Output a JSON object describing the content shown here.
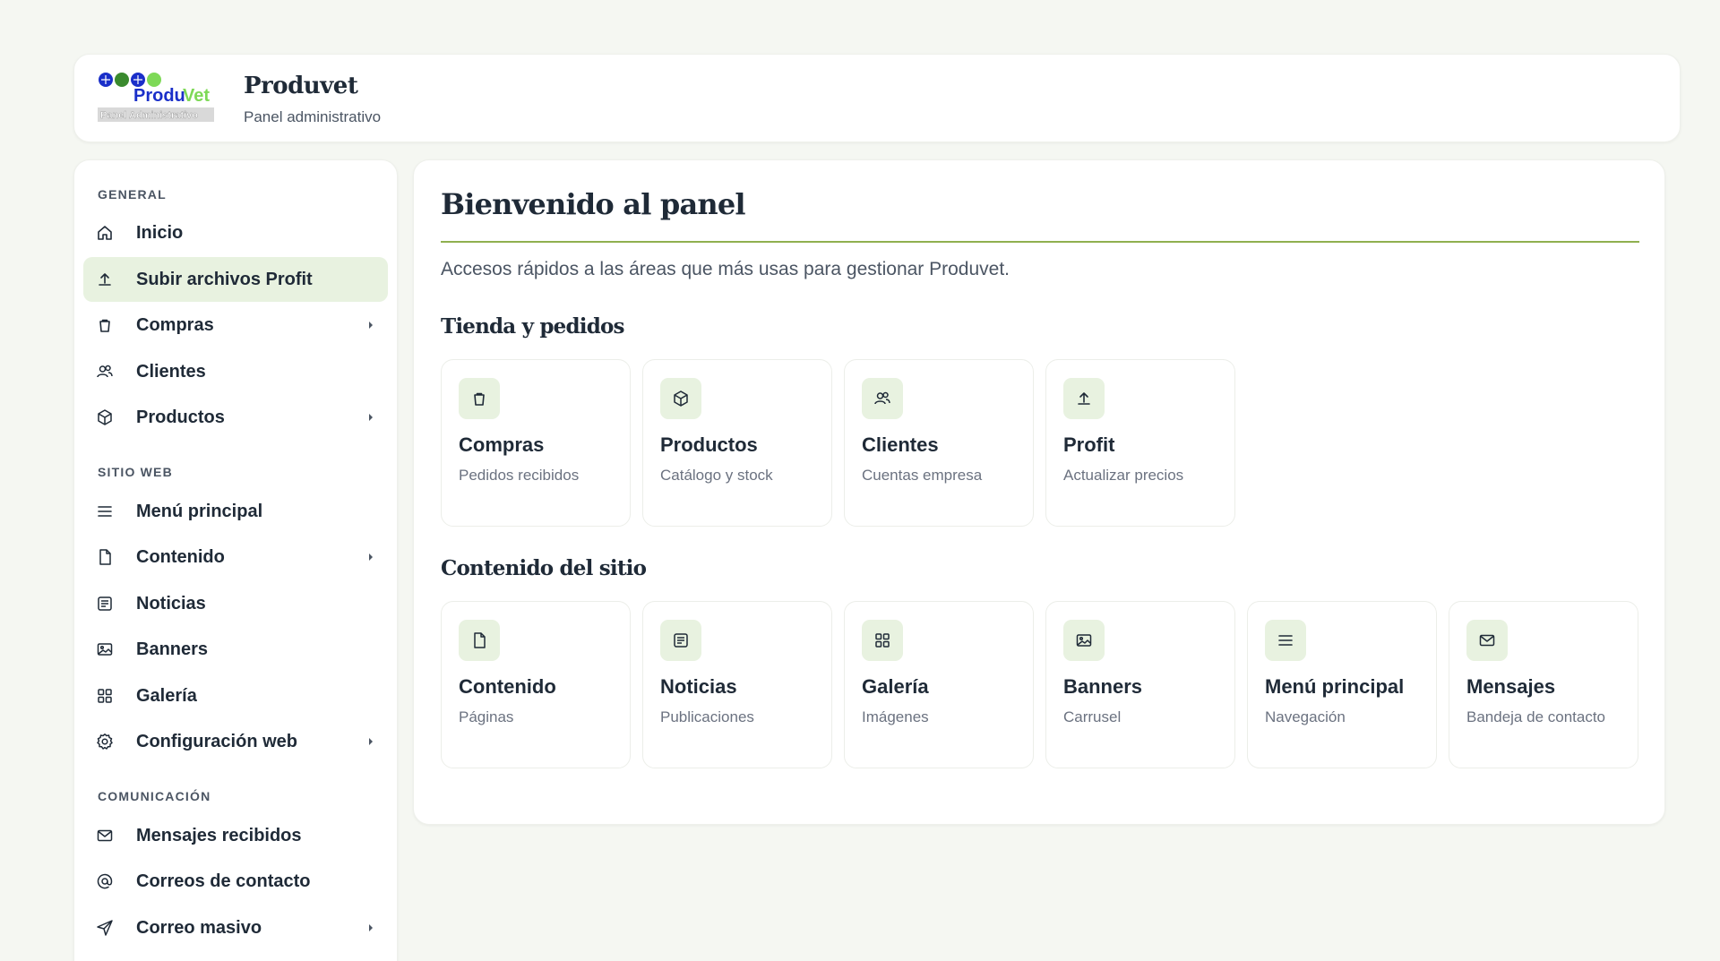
{
  "header": {
    "logo_text": "ProduVet",
    "logo_sub": "Panel Administrativo",
    "title": "Produvet",
    "subtitle": "Panel administrativo"
  },
  "sidebar": {
    "sections": [
      {
        "label": "GENERAL"
      },
      {
        "label": "SITIO WEB"
      },
      {
        "label": "COMUNICACIÓN"
      }
    ],
    "items": [
      {
        "label": "Inicio",
        "icon": "home-icon"
      },
      {
        "label": "Subir archivos Profit",
        "icon": "upload-icon",
        "active": true
      },
      {
        "label": "Compras",
        "icon": "bag-icon",
        "has_submenu": true
      },
      {
        "label": "Clientes",
        "icon": "users-icon"
      },
      {
        "label": "Productos",
        "icon": "box-icon",
        "has_submenu": true
      },
      {
        "label": "Menú principal",
        "icon": "menu-icon"
      },
      {
        "label": "Contenido",
        "icon": "file-icon",
        "has_submenu": true
      },
      {
        "label": "Noticias",
        "icon": "news-icon"
      },
      {
        "label": "Banners",
        "icon": "image-icon"
      },
      {
        "label": "Galería",
        "icon": "grid-icon"
      },
      {
        "label": "Configuración web",
        "icon": "gear-icon",
        "has_submenu": true
      },
      {
        "label": "Mensajes recibidos",
        "icon": "mail-icon"
      },
      {
        "label": "Correos de contacto",
        "icon": "at-icon"
      },
      {
        "label": "Correo masivo",
        "icon": "send-icon",
        "has_submenu": true
      }
    ]
  },
  "main": {
    "title": "Bienvenido al panel",
    "description": "Accesos rápidos a las áreas que más usas para gestionar Produvet.",
    "groups": [
      {
        "title": "Tienda y pedidos",
        "cards": [
          {
            "title": "Compras",
            "subtitle": "Pedidos recibidos",
            "icon": "bag-icon"
          },
          {
            "title": "Productos",
            "subtitle": "Catálogo y stock",
            "icon": "box-icon"
          },
          {
            "title": "Clientes",
            "subtitle": "Cuentas empresa",
            "icon": "users-icon"
          },
          {
            "title": "Profit",
            "subtitle": "Actualizar precios",
            "icon": "upload-icon"
          }
        ]
      },
      {
        "title": "Contenido del sitio",
        "cards": [
          {
            "title": "Contenido",
            "subtitle": "Páginas",
            "icon": "file-icon"
          },
          {
            "title": "Noticias",
            "subtitle": "Publicaciones",
            "icon": "news-icon"
          },
          {
            "title": "Galería",
            "subtitle": "Imágenes",
            "icon": "grid-icon"
          },
          {
            "title": "Banners",
            "subtitle": "Carrusel",
            "icon": "image-icon"
          },
          {
            "title": "Menú principal",
            "subtitle": "Navegación",
            "icon": "menu-icon"
          },
          {
            "title": "Mensajes",
            "subtitle": "Bandeja de contacto",
            "icon": "mail-icon"
          }
        ]
      }
    ]
  },
  "colors": {
    "accent": "#8fb04f",
    "active_bg": "#e8f2e0",
    "text": "#1f2a37",
    "muted": "#6b7280",
    "background": "#f5f7f2"
  }
}
